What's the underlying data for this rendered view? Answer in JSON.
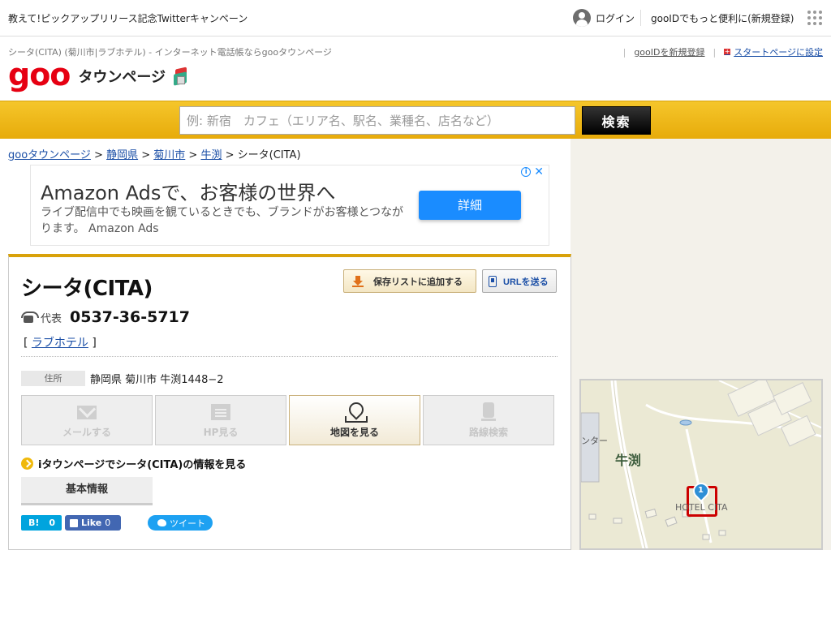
{
  "topbar": {
    "campaign": "教えて!ピックアップリリース記念Twitterキャンペーン",
    "login": "ログイン",
    "register": "gooIDでもっと便利に(新規登録)"
  },
  "header": {
    "subtitle": "シータ(CITA) (菊川市|ラブホテル) - インターネット電話帳ならgooタウンページ",
    "logo_goo": "goo",
    "logo_tp": "タウンページ",
    "link_register": "gooIDを新規登録",
    "link_start": "スタートページに設定"
  },
  "search": {
    "placeholder": "例: 新宿　カフェ（エリア名、駅名、業種名、店名など）",
    "button": "検索"
  },
  "breadcrumb": {
    "items": [
      "gooタウンページ",
      "静岡県",
      "菊川市",
      "牛渕"
    ],
    "sep": " > ",
    "current": "シータ(CITA)"
  },
  "ad": {
    "title": "Amazon Adsで、お客様の世界へ",
    "text": "ライブ配信中でも映画を観ているときでも、ブランドがお客様とつながります。 Amazon Ads",
    "button": "詳細",
    "choices": "i",
    "close": "✕"
  },
  "listing": {
    "name": "シータ(CITA)",
    "save_button": "保存リストに追加する",
    "url_button": "URLを送る",
    "phone_label": "代表",
    "phone": "0537-36-5717",
    "category_open": "[ ",
    "category": "ラブホテル",
    "category_close": " ]",
    "address_label": "住所",
    "address": "静岡県 菊川市 牛渕1448−2",
    "actions": [
      "メールする",
      "HP見る",
      "地図を見る",
      "路線検索"
    ],
    "itown": "iタウンページでシータ(CITA)の情報を見る",
    "tab_basic": "基本情報"
  },
  "social": {
    "hatena": "B!",
    "hatena_count": "0",
    "fb_like": "Like",
    "fb_count": "0",
    "tweet": "ツイート"
  },
  "map": {
    "place": "牛渕",
    "side": "ンター",
    "hotel": "HOTEL CITA",
    "pin": "1"
  }
}
